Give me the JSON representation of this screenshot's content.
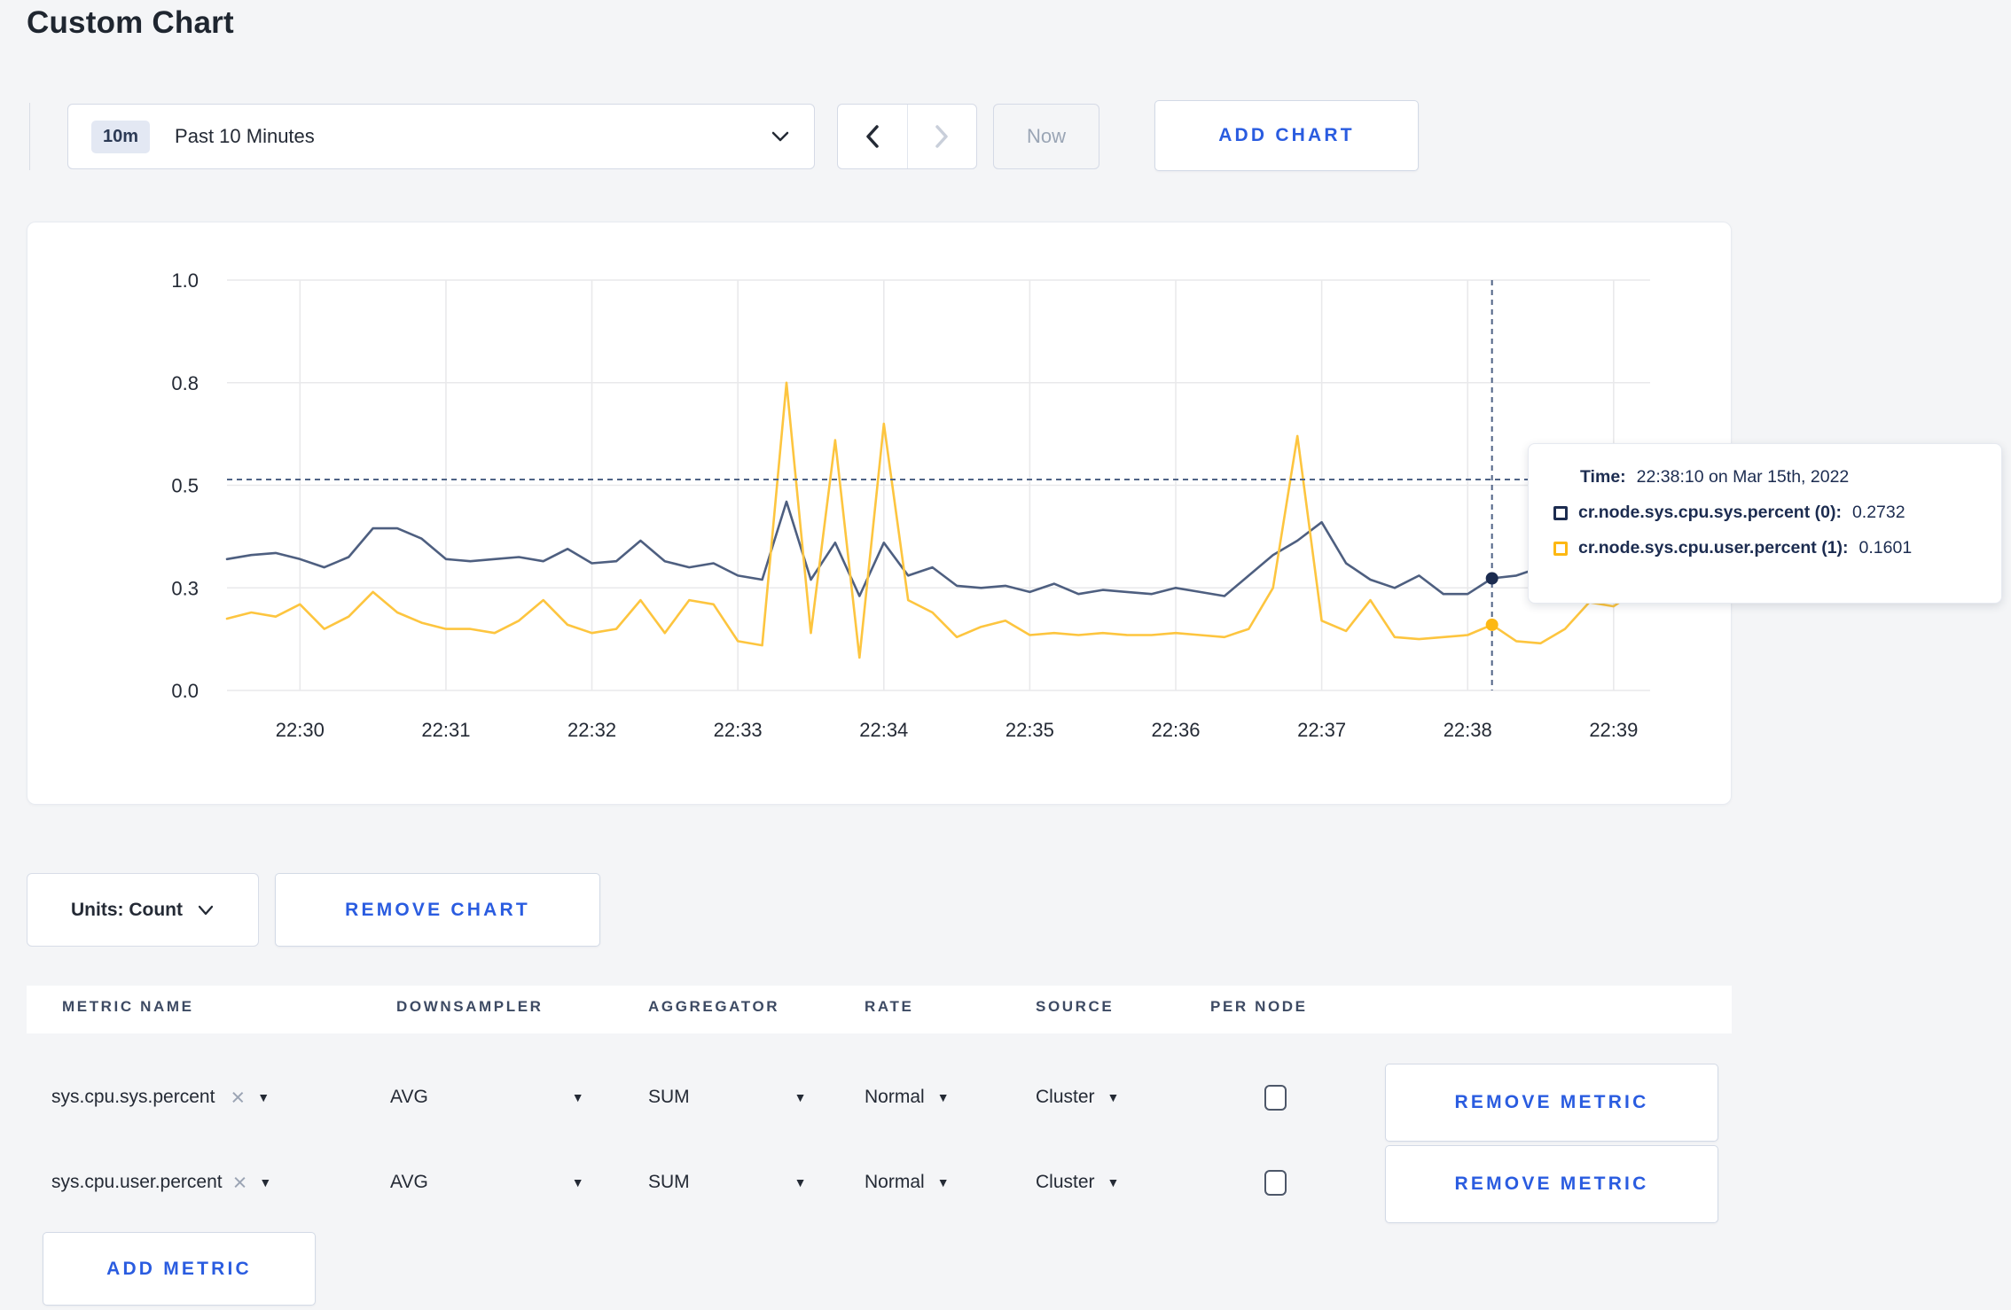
{
  "page": {
    "title": "Custom Chart",
    "background": "#f4f5f7",
    "accent_blue": "#2a5ce0"
  },
  "toolbar": {
    "range_badge": "10m",
    "range_label": "Past 10 Minutes",
    "now_label": "Now",
    "add_chart_label": "ADD CHART"
  },
  "chart_data": {
    "type": "line",
    "title": "",
    "xlabel": "",
    "ylabel": "",
    "grid": true,
    "legend_position": "tooltip-overlay",
    "x_axis": {
      "start_time": "22:29:30",
      "end_time": "22:39:15",
      "point_interval_s": 10,
      "tick_labels": [
        "22:30",
        "22:31",
        "22:32",
        "22:33",
        "22:34",
        "22:35",
        "22:36",
        "22:37",
        "22:38",
        "22:39"
      ],
      "tick_times_s": [
        30,
        90,
        150,
        210,
        270,
        330,
        390,
        450,
        510,
        570
      ]
    },
    "y_axis": {
      "range": [
        0,
        1
      ],
      "gridline_values": [
        0,
        0.25,
        0.5,
        0.75,
        1.0
      ],
      "tick_labels": [
        "0.0",
        "0.3",
        "0.5",
        "0.8",
        "1.0"
      ]
    },
    "series": [
      {
        "name": "cr.node.sys.cpu.sys.percent (0)",
        "color": "#4e5f80",
        "marker_color": "#1c2c50",
        "values": [
          0.32,
          0.33,
          0.335,
          0.32,
          0.3,
          0.325,
          0.395,
          0.395,
          0.37,
          0.32,
          0.315,
          0.32,
          0.325,
          0.315,
          0.345,
          0.31,
          0.315,
          0.365,
          0.315,
          0.3,
          0.31,
          0.28,
          0.27,
          0.46,
          0.27,
          0.36,
          0.23,
          0.36,
          0.28,
          0.3,
          0.255,
          0.25,
          0.255,
          0.24,
          0.26,
          0.235,
          0.245,
          0.24,
          0.235,
          0.25,
          0.24,
          0.23,
          0.28,
          0.33,
          0.365,
          0.41,
          0.31,
          0.27,
          0.25,
          0.28,
          0.235,
          0.235,
          0.2732,
          0.28,
          0.3,
          0.285,
          0.275,
          0.29,
          0.3
        ]
      },
      {
        "name": "cr.node.sys.cpu.user.percent (1)",
        "color": "#fdc53f",
        "marker_color": "#fdb813",
        "values": [
          0.175,
          0.19,
          0.18,
          0.21,
          0.15,
          0.18,
          0.24,
          0.19,
          0.165,
          0.15,
          0.15,
          0.14,
          0.17,
          0.22,
          0.16,
          0.14,
          0.15,
          0.22,
          0.14,
          0.22,
          0.21,
          0.12,
          0.11,
          0.75,
          0.14,
          0.61,
          0.08,
          0.65,
          0.22,
          0.19,
          0.13,
          0.155,
          0.17,
          0.135,
          0.14,
          0.135,
          0.14,
          0.135,
          0.135,
          0.14,
          0.135,
          0.13,
          0.15,
          0.25,
          0.62,
          0.17,
          0.145,
          0.22,
          0.13,
          0.125,
          0.13,
          0.135,
          0.1601,
          0.12,
          0.115,
          0.15,
          0.215,
          0.205,
          0.245
        ]
      }
    ],
    "crosshair": {
      "time_s": 520,
      "time_label": "22:38:10",
      "hline_value": 0.514,
      "values_at_crosshair": [
        0.2732,
        0.1601
      ]
    }
  },
  "tooltip": {
    "time_label": "Time:",
    "time_value": "22:38:10 on Mar 15th, 2022",
    "rows": [
      {
        "label": "cr.node.sys.cpu.sys.percent (0):",
        "value": "0.2732",
        "color": "#1c2c50"
      },
      {
        "label": "cr.node.sys.cpu.user.percent (1):",
        "value": "0.1601",
        "color": "#fdb813"
      }
    ]
  },
  "chart_footer": {
    "units_label": "Units: Count",
    "remove_chart_label": "REMOVE CHART"
  },
  "metrics_table": {
    "headers": [
      "METRIC NAME",
      "DOWNSAMPLER",
      "AGGREGATOR",
      "RATE",
      "SOURCE",
      "PER NODE"
    ],
    "rows": [
      {
        "name": "sys.cpu.sys.percent",
        "downsampler": "AVG",
        "aggregator": "SUM",
        "rate": "Normal",
        "source": "Cluster",
        "per_node_checked": false
      },
      {
        "name": "sys.cpu.user.percent",
        "downsampler": "AVG",
        "aggregator": "SUM",
        "rate": "Normal",
        "source": "Cluster",
        "per_node_checked": false
      }
    ],
    "remove_metric_label": "REMOVE METRIC",
    "add_metric_label": "ADD METRIC"
  },
  "icons": {
    "dropdown_arrow": "▼",
    "close": "×"
  }
}
